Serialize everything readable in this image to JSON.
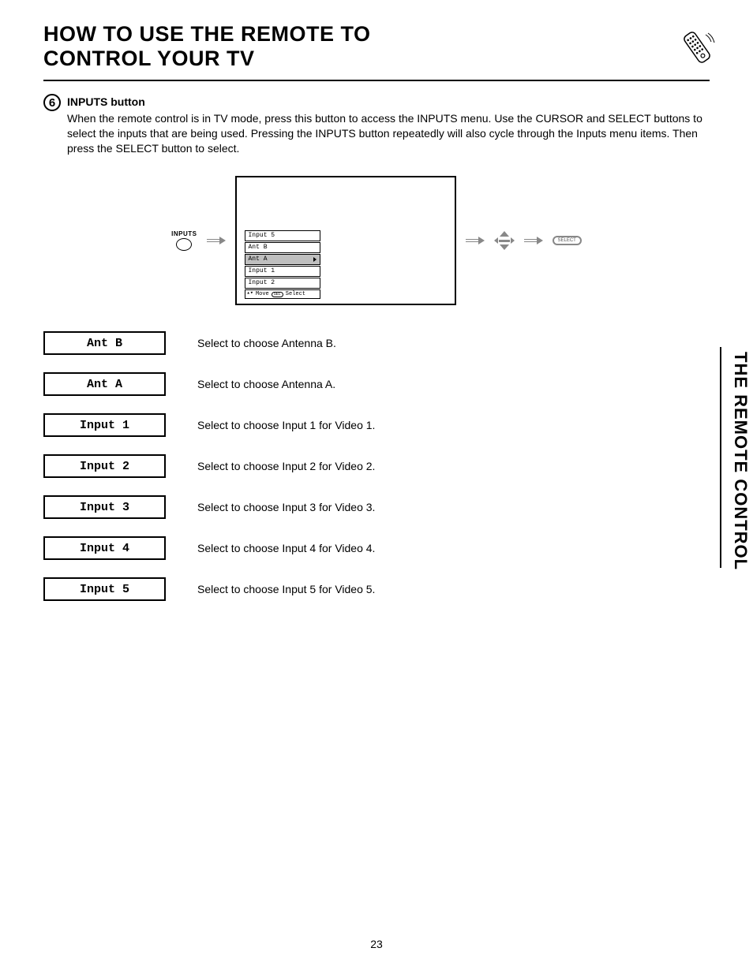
{
  "header": {
    "title_line1": "HOW TO USE THE REMOTE TO",
    "title_line2": "CONTROL YOUR TV"
  },
  "section": {
    "step_number": "6",
    "heading": "INPUTS button",
    "body": "When the remote control is in TV mode, press this button to access the INPUTS menu.  Use the CURSOR and SELECT buttons to select the inputs that are being used.  Pressing the INPUTS button repeatedly will also cycle through the Inputs menu items.  Then press the SELECT button to select."
  },
  "diagram": {
    "inputs_button_label": "INPUTS",
    "osd_items": [
      "Input 5",
      "Ant B",
      "Ant A",
      "Input 1",
      "Input 2"
    ],
    "osd_selected_index": 2,
    "osd_hint_move": "Move",
    "osd_hint_sel_pill": "SEL",
    "osd_hint_select": "Select",
    "select_pill_text": "SELECT"
  },
  "inputs_table": [
    {
      "label": "Ant B",
      "desc": "Select to choose Antenna B."
    },
    {
      "label": "Ant A",
      "desc": "Select to choose Antenna A."
    },
    {
      "label": "Input 1",
      "desc": "Select to choose Input 1 for Video 1."
    },
    {
      "label": "Input 2",
      "desc": "Select to choose Input 2 for Video 2."
    },
    {
      "label": "Input 3",
      "desc": "Select to choose Input 3 for Video 3."
    },
    {
      "label": "Input 4",
      "desc": "Select to choose Input 4 for Video 4."
    },
    {
      "label": "Input 5",
      "desc": "Select to choose Input 5 for Video 5."
    }
  ],
  "side_tab": "THE REMOTE CONTROL",
  "page_number": "23"
}
